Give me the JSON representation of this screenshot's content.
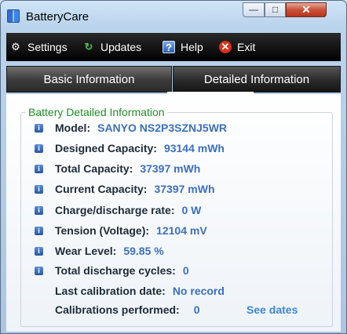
{
  "window": {
    "title": "BatteryCare"
  },
  "menu": [
    {
      "label": "Settings",
      "icon": "gear-icon"
    },
    {
      "label": "Updates",
      "icon": "refresh-icon"
    },
    {
      "label": "Help",
      "icon": "help-icon"
    },
    {
      "label": "Exit",
      "icon": "exit-icon"
    }
  ],
  "tabs": [
    {
      "label": "Basic Information",
      "active": false
    },
    {
      "label": "Detailed Information",
      "active": true
    }
  ],
  "group_title": "Battery Detailed Information",
  "details": [
    {
      "label": "Model:",
      "value": "SANYO NS2P3SZNJ5WR"
    },
    {
      "label": "Designed Capacity:",
      "value": "93144 mWh"
    },
    {
      "label": "Total Capacity:",
      "value": "37397 mWh"
    },
    {
      "label": "Current Capacity:",
      "value": "37397 mWh"
    },
    {
      "label": "Charge/discharge rate:",
      "value": "0 W"
    },
    {
      "label": "Tension (Voltage):",
      "value": "12104 mV"
    },
    {
      "label": "Wear Level:",
      "value": "59.85 %"
    },
    {
      "label": "Total discharge cycles:",
      "value": "0"
    }
  ],
  "calibration": [
    {
      "label": "Last calibration date:",
      "value": "No record"
    },
    {
      "label": "Calibrations performed:",
      "value": "0"
    }
  ],
  "see_dates_link": "See dates",
  "colors": {
    "label": "#1d2a38",
    "value": "#3b6fbe",
    "group_title": "#1f8f25",
    "link": "#3b86d8"
  }
}
